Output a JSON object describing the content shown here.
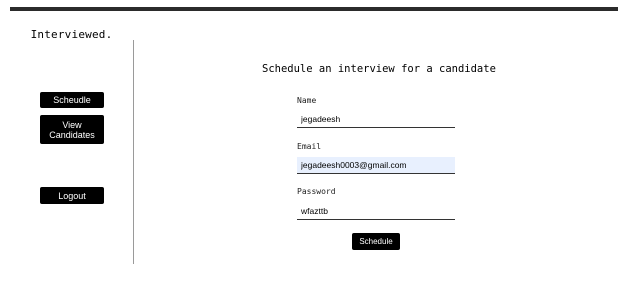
{
  "app": {
    "brand": "Interviewed."
  },
  "sidebar": {
    "items": [
      {
        "label": "Scheudle"
      },
      {
        "label": "View Candidates"
      },
      {
        "label": "Logout"
      }
    ]
  },
  "form": {
    "title": "Schedule an interview for a candidate",
    "name": {
      "label": "Name",
      "value": "jegadeesh"
    },
    "email": {
      "label": "Email",
      "value": "jegadeesh0003@gmail.com"
    },
    "password": {
      "label": "Password",
      "value": "wfazttb"
    },
    "submit_label": "Schedule"
  },
  "colors": {
    "top_bar": "#2b2b2b",
    "button_bg": "#000000",
    "autofill_bg": "#e8f0fe"
  }
}
